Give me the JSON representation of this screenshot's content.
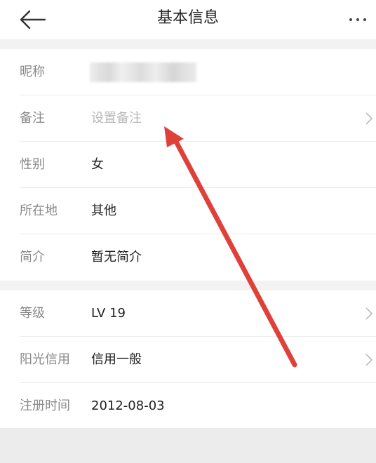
{
  "header": {
    "title": "基本信息",
    "back_icon": "arrow-left-icon",
    "more_icon": "more-dots-icon"
  },
  "profile": {
    "rows": [
      {
        "label": "昵称",
        "value": ""
      },
      {
        "label": "备注",
        "value": "设置备注"
      },
      {
        "label": "性别",
        "value": "女"
      },
      {
        "label": "所在地",
        "value": "其他"
      },
      {
        "label": "简介",
        "value": "暂无简介"
      }
    ]
  },
  "account": {
    "rows": [
      {
        "label": "等级",
        "value": "LV 19"
      },
      {
        "label": "阳光信用",
        "value": "信用一般"
      },
      {
        "label": "注册时间",
        "value": "2012-08-03"
      }
    ]
  },
  "colors": {
    "annotation_arrow": "#e0403a",
    "label_text": "#8a8a8a",
    "value_text": "#222222",
    "placeholder_text": "#b8b8b8"
  }
}
